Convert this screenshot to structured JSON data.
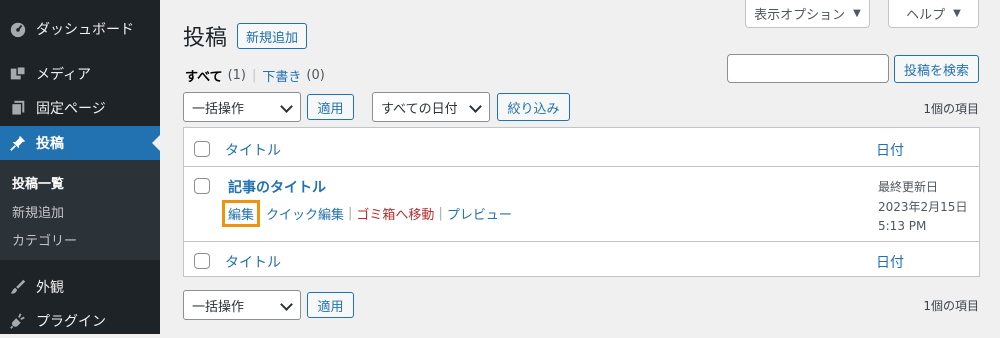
{
  "sidebar": {
    "items": [
      {
        "label": "ダッシュボード",
        "icon": "dashboard-icon"
      },
      {
        "label": "メディア",
        "icon": "media-icon"
      },
      {
        "label": "固定ページ",
        "icon": "pages-icon"
      },
      {
        "label": "投稿",
        "icon": "pin-icon"
      },
      {
        "label": "外観",
        "icon": "brush-icon"
      },
      {
        "label": "プラグイン",
        "icon": "plugin-icon"
      }
    ],
    "submenu": [
      "投稿一覧",
      "新規追加",
      "カテゴリー"
    ]
  },
  "screen_options": {
    "label": "表示オプション",
    "help": "ヘルプ"
  },
  "header": {
    "title": "投稿",
    "add_new": "新規追加"
  },
  "filters": {
    "all_label": "すべて",
    "all_count": "(1)",
    "drafts_label": "下書き",
    "drafts_count": "(0)"
  },
  "search": {
    "button": "投稿を検索",
    "value": ""
  },
  "bulk": {
    "select": "一括操作",
    "apply": "適用"
  },
  "date_filter": {
    "select": "すべての日付",
    "filter_button": "絞り込み"
  },
  "items_count": "1個の項目",
  "table": {
    "col_title": "タイトル",
    "col_date": "日付",
    "post": {
      "title": "記事のタイトル",
      "actions": {
        "edit": "編集",
        "quick_edit": "クイック編集",
        "trash": "ゴミ箱へ移動",
        "preview": "プレビュー"
      },
      "date_status": "最終更新日",
      "date": "2023年2月15日",
      "time": "5:13 PM"
    }
  },
  "colors": {
    "accent": "#2271b1",
    "sidebar": "#1d2327",
    "highlight": "#f0930c",
    "trash": "#b32d2e"
  }
}
